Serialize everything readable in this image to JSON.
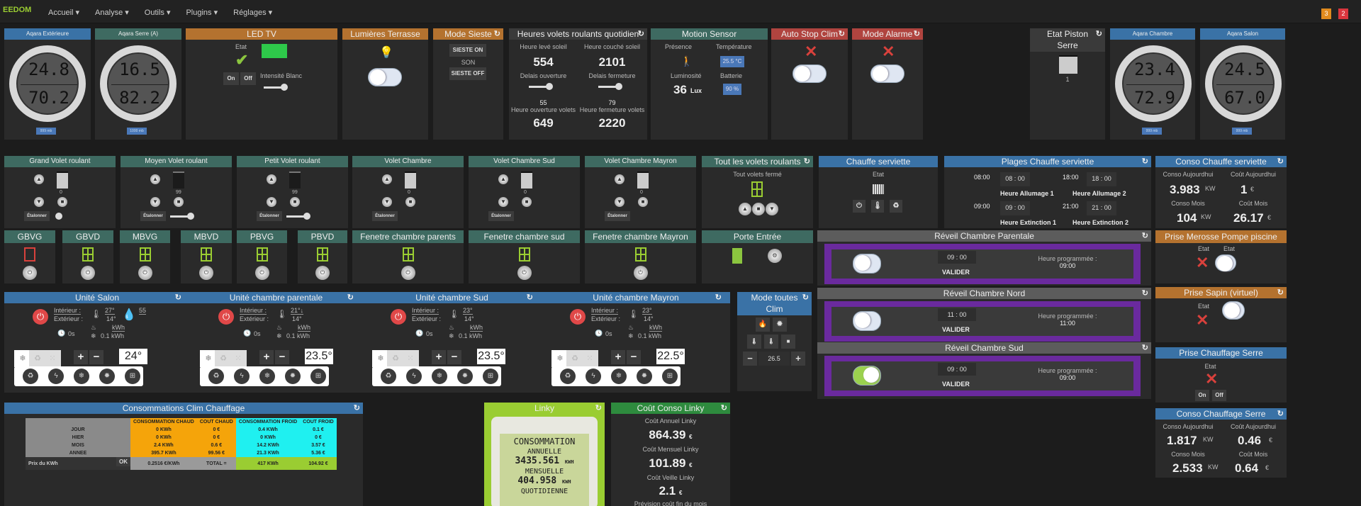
{
  "nav": {
    "brand": "EEDOM",
    "menu": [
      "Accueil ▾",
      "Analyse ▾",
      "Outils ▾",
      "Plugins ▾",
      "Réglages ▾"
    ],
    "badges": [
      "3",
      "2"
    ],
    "colors": {
      "badge1": "#e08a1e",
      "badge2": "#d9363e"
    }
  },
  "aqara_ext": {
    "title": "Aqara Extérieure",
    "temp": "24.8",
    "hum": "70.2",
    "pressure": "999 mb"
  },
  "aqara_serre": {
    "title": "Aqara Serre (A)",
    "temp": "16.5",
    "hum": "82.2",
    "pressure": "1000 mb"
  },
  "led_tv": {
    "title": "LED TV",
    "etat": "Etat",
    "on": "On",
    "off": "Off",
    "intensite": "Intensité Blanc"
  },
  "lumieres": {
    "title": "Lumières Terrasse"
  },
  "sieste": {
    "title": "Mode Sieste",
    "on": "SIESTE ON",
    "son": "SON",
    "off": "SIESTE OFF"
  },
  "heures": {
    "title": "Heures volets roulants quotidien",
    "leve_l": "Heure levé soleil",
    "leve": "554",
    "couche_l": "Heure couché soleil",
    "couche": "2101",
    "delai_o": "Delais ouverture",
    "delai_f": "Delais fermeture",
    "delai_o_v": "55",
    "delai_f_v": "79",
    "ouv_l": "Heure ouverture volets",
    "ouv": "649",
    "ferm_l": "Heure fermeture volets",
    "ferm": "2220"
  },
  "motion": {
    "title": "Motion Sensor",
    "presence": "Présence",
    "temp_l": "Température",
    "temp": "25.5 °C",
    "lum_l": "Luminosité",
    "lum": "36",
    "lux": "Lux",
    "batt_l": "Batterie",
    "batt": "90 %"
  },
  "auto_stop": {
    "title": "Auto Stop Clim"
  },
  "alarme": {
    "title": "Mode Alarme"
  },
  "piston": {
    "title": "Etat Piston Serre",
    "value": "1"
  },
  "aqara_ch": {
    "title": "Aqara Chambre",
    "temp": "23.4",
    "hum": "72.9",
    "pressure": "999 mb"
  },
  "aqara_sal": {
    "title": "Aqara Salon",
    "temp": "24.5",
    "hum": "67.0",
    "pressure": "999 mb"
  },
  "volets": [
    {
      "title": "Grand Volet roulant",
      "pos": "0",
      "etal": "Étalonner"
    },
    {
      "title": "Moyen Volet roulant",
      "pos": "99",
      "etal": "Étalonner"
    },
    {
      "title": "Petit Volet roulant",
      "pos": "99",
      "etal": "Étalonner"
    },
    {
      "title": "Volet Chambre",
      "pos": "0",
      "etal": "Étalonner"
    },
    {
      "title": "Volet Chambre Sud",
      "pos": "0",
      "etal": "Étalonner"
    },
    {
      "title": "Volet Chambre Mayron",
      "pos": "0",
      "etal": "Étalonner"
    }
  ],
  "tous_volets": {
    "title": "Tout les volets roulants",
    "state": "Tout volets fermé"
  },
  "chauffe": {
    "title": "Chauffe serviette",
    "etat": "Etat"
  },
  "plages": {
    "title": "Plages Chauffe serviette",
    "a1": "08:00",
    "a1v": "08 : 00",
    "a1l": "Heure Allumage 1",
    "a2": "18:00",
    "a2v": "18 : 00",
    "a2l": "Heure Allumage 2",
    "e1": "09:00",
    "e1v": "09 : 00",
    "e1l": "Heure Extinction 1",
    "e2": "21:00",
    "e2v": "21 : 00",
    "e2l": "Heure Extinction 2"
  },
  "conso_cs": {
    "title": "Conso Chauffe serviette",
    "ca_l": "Conso Aujourdhui",
    "ca": "3.983",
    "kw": "KW",
    "cta_l": "Coût Aujourdhui",
    "cta": "1",
    "eur": "€",
    "cm_l": "Conso Mois",
    "cm": "104",
    "ctm_l": "Coût Mois",
    "ctm": "26.17"
  },
  "ouvrants": [
    {
      "title": "GBVG"
    },
    {
      "title": "GBVD"
    },
    {
      "title": "MBVG"
    },
    {
      "title": "MBVD"
    },
    {
      "title": "PBVG"
    },
    {
      "title": "PBVD"
    },
    {
      "title": "Fenetre chambre parents"
    },
    {
      "title": "Fenetre chambre sud"
    },
    {
      "title": "Fenetre chambre Mayron"
    }
  ],
  "porte": {
    "title": "Porte Entrée"
  },
  "reveils": [
    {
      "title": "Réveil Chambre Parentale",
      "time": "09 : 00",
      "valider": "VALIDER",
      "prog_l": "Heure programmée :",
      "prog": "09:00"
    },
    {
      "title": "Réveil Chambre Nord",
      "time": "11 : 00",
      "valider": "VALIDER",
      "prog_l": "Heure programmée :",
      "prog": "11:00"
    },
    {
      "title": "Réveil Chambre Sud",
      "time": "09 : 00",
      "valider": "VALIDER",
      "prog_l": "Heure programmée :",
      "prog": "09:00"
    }
  ],
  "prise_merosse": {
    "title": "Prise Merosse Pompe piscine",
    "etat1": "Etat",
    "etat2": "Etat"
  },
  "prise_sapin": {
    "title": "Prise Sapin (virtuel)",
    "etat": "Etat"
  },
  "prise_serre": {
    "title": "Prise Chauffage Serre",
    "etat": "Etat",
    "on": "On",
    "off": "Off"
  },
  "conso_serre": {
    "title": "Conso Chauffage Serre",
    "ca_l": "Conso Aujourdhui",
    "ca": "1.817",
    "kw": "KW",
    "cta_l": "Coût Aujourdhui",
    "cta": "0.46",
    "eur": "€",
    "cm_l": "Conso Mois",
    "cm": "2.533",
    "ctm_l": "Coût Mois",
    "ctm": "0.64"
  },
  "clims": [
    {
      "title": "Unité Salon",
      "int": "Intérieur :",
      "ext": "Extérieur :",
      "ti": "27°",
      "te": "14°",
      "hum": "55",
      "timer": "0s",
      "kwh_h": "kWh",
      "kwh_c": "0.1 kWh",
      "set": "24°"
    },
    {
      "title": "Unité chambre parentale",
      "int": "Intérieur :",
      "ext": "Extérieur :",
      "ti": "21°↓",
      "te": "14°",
      "timer": "0s",
      "kwh_h": "kWh",
      "kwh_c": "0.1 kWh",
      "set": "23.5°"
    },
    {
      "title": "Unité chambre Sud",
      "int": "Intérieur :",
      "ext": "Extérieur :",
      "ti": "23°",
      "te": "14°",
      "timer": "0s",
      "kwh_h": "kWh",
      "kwh_c": "0.1 kWh",
      "set": "23.5°"
    },
    {
      "title": "Unité chambre Mayron",
      "int": "Intérieur :",
      "ext": "Extérieur :",
      "ti": "23°",
      "te": "14°",
      "timer": "0s",
      "kwh_h": "kWh",
      "kwh_c": "0.1 kWh",
      "set": "22.5°"
    }
  ],
  "mode_clim": {
    "title": "Mode toutes Clim",
    "value": "26.5",
    "minus": "−",
    "plus": "+"
  },
  "conso_clim": {
    "title": "Consommations Clim Chauffage",
    "headers": [
      "CONSOMMATION CHAUD",
      "COUT CHAUD",
      "CONSOMMATION FROID",
      "COUT FROID"
    ],
    "rows": [
      [
        "JOUR",
        "0 KWh",
        "0 €",
        "0.4 KWh",
        "0.1 €"
      ],
      [
        "HIER",
        "0 KWh",
        "0 €",
        "0 KWh",
        "0 €"
      ],
      [
        "MOIS",
        "2.4 KWh",
        "0.6 €",
        "14.2 KWh",
        "3.57 €"
      ],
      [
        "ANNEE",
        "395.7 KWh",
        "99.56 €",
        "21.3 KWh",
        "5.36 €"
      ]
    ],
    "prix_l": "Prix du KWh",
    "ok": "OK",
    "prix": "0.2516 €/KWh",
    "total_l": "TOTAL =",
    "total_kwh": "417 KWh",
    "total_eur": "104.92 €"
  },
  "linky": {
    "title": "Linky",
    "conso": "CONSOMMATION",
    "annuelle": "ANNUELLE",
    "an_v": "3435.561",
    "mensuelle": "MENSUELLE",
    "men_v": "404.958",
    "kwh": "KWH",
    "quot": "QUOTIDIENNE"
  },
  "cout_linky": {
    "title": "Coût Conso Linky",
    "an_l": "Coût Annuel Linky",
    "an": "864.39",
    "men_l": "Coût Mensuel Linky",
    "men": "101.89",
    "veille_l": "Coût Veille Linky",
    "veille": "2.1",
    "eur": "€",
    "prev_l": "Prévision coût fin du mois"
  }
}
